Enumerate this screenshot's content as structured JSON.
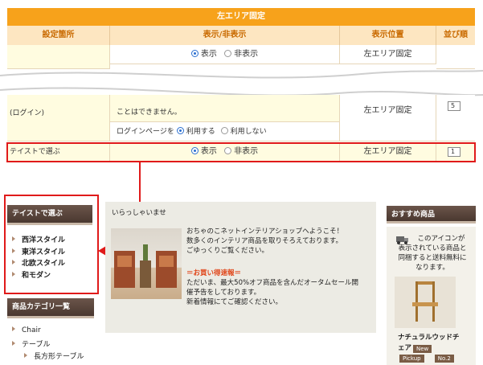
{
  "table": {
    "title": "左エリア固定",
    "headers": [
      "設定箇所",
      "表示/非表示",
      "表示位置",
      "並び順"
    ],
    "row1": {
      "show": "表示",
      "hide": "非表示",
      "position": "左エリア固定"
    },
    "row2": {
      "label": "(ログイン)",
      "note": "ことはできません。",
      "login_label": "ログインページを",
      "use": "利用する",
      "not_use": "利用しない",
      "position": "左エリア固定",
      "order": "5"
    },
    "row3": {
      "label": "テイストで選ぶ",
      "show": "表示",
      "hide": "非表示",
      "position": "左エリア固定",
      "order": "1"
    }
  },
  "sidebar": {
    "taste_title": "テイストで選ぶ",
    "taste_items": [
      "西洋スタイル",
      "東洋スタイル",
      "北欧スタイル",
      "和モダン"
    ],
    "category_title": "商品カテゴリ一覧",
    "category_items": [
      "Chair",
      "テーブル"
    ],
    "category_sub": [
      "長方形テーブル"
    ]
  },
  "content": {
    "greeting": "いらっしゃいませ",
    "lines": [
      "おちゃのこネットインテリアショップへようこそ！",
      "数多くのインテリア商品を取りそろえております。",
      "ごゆっくりご覧ください。"
    ],
    "sale_title": "＝お買い得速報＝",
    "sale_lines": [
      "ただいま、最大50%オフ商品を含んだオータムセール開",
      "催予告をしております。",
      "新着情報にてご確認ください。"
    ]
  },
  "recommend": {
    "title": "おすすめ商品",
    "note_lines": [
      "このアイコンが",
      "表示されている商品と",
      "同梱すると送料無料に",
      "なります。"
    ],
    "product_name_lines": [
      "ナチュラルウッドチ",
      "ェア"
    ],
    "badges": [
      "New",
      "Pickup",
      "No.2"
    ]
  },
  "colors": {
    "orange": "#f7a21b",
    "highlight": "#e01a1a",
    "sidebar_brown": "#5b463b"
  },
  "icons": [
    "truck-icon",
    "radio-icon",
    "arrow-icon"
  ]
}
